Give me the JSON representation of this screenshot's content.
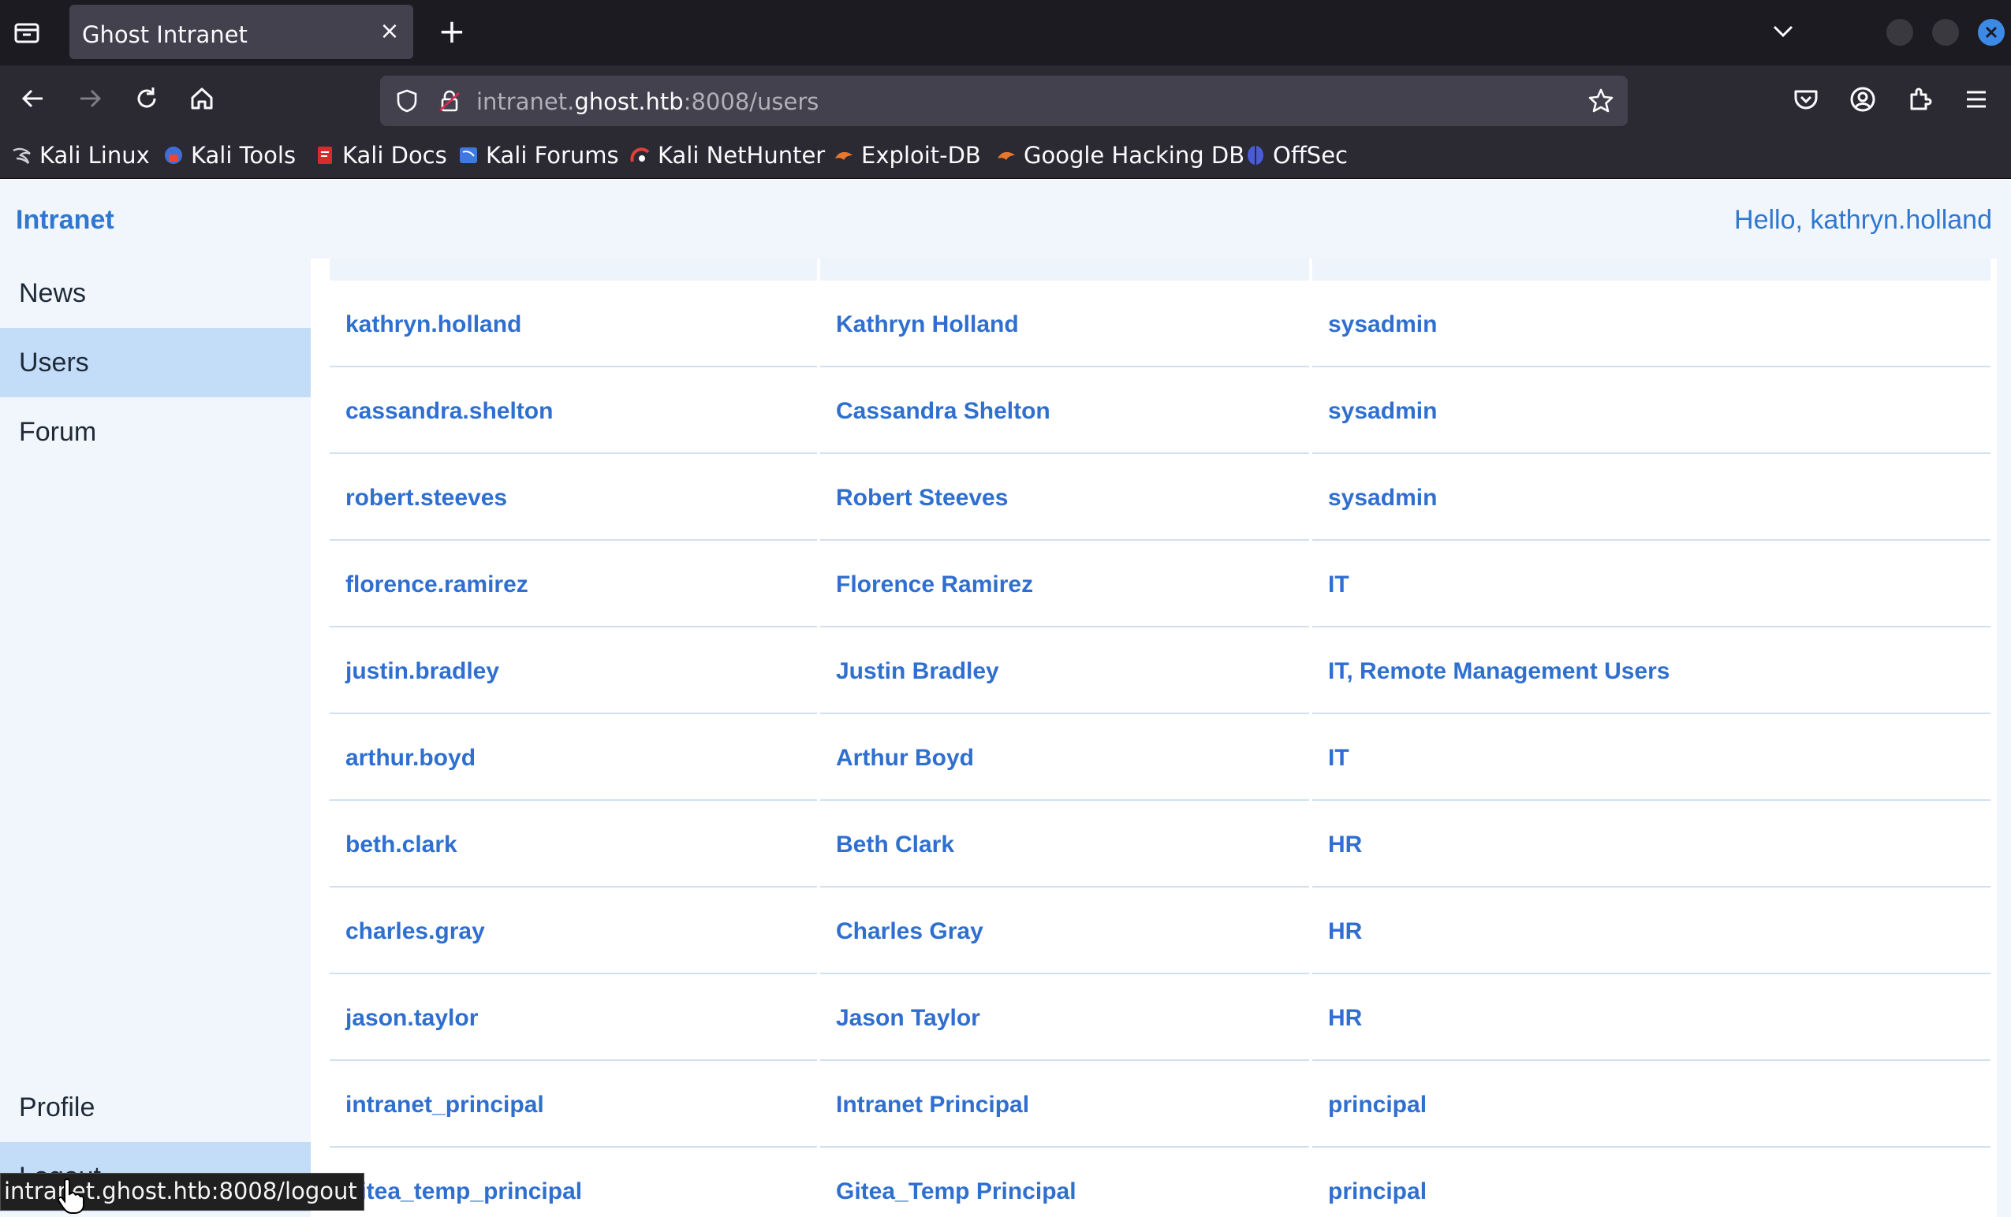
{
  "browser": {
    "tab_title": "Ghost Intranet",
    "url_prefix": "intranet.",
    "url_host": "ghost.htb",
    "url_suffix": ":8008/users",
    "status_url": "intranet.ghost.htb:8008/logout",
    "bookmarks": [
      {
        "label": "Kali Linux",
        "icon": "kali-dragon-icon"
      },
      {
        "label": "Kali Tools",
        "icon": "kali-tools-icon"
      },
      {
        "label": "Kali Docs",
        "icon": "kali-docs-icon"
      },
      {
        "label": "Kali Forums",
        "icon": "kali-forums-icon"
      },
      {
        "label": "Kali NetHunter",
        "icon": "kali-nethunter-icon"
      },
      {
        "label": "Exploit-DB",
        "icon": "exploit-db-icon"
      },
      {
        "label": "Google Hacking DB",
        "icon": "ghdb-icon"
      },
      {
        "label": "OffSec",
        "icon": "offsec-icon"
      }
    ]
  },
  "app": {
    "brand": "Intranet",
    "greeting": "Hello, kathryn.holland"
  },
  "sidebar": {
    "items": [
      {
        "label": "News",
        "active": false
      },
      {
        "label": "Users",
        "active": true
      },
      {
        "label": "Forum",
        "active": false
      }
    ],
    "bottom": [
      {
        "label": "Profile"
      },
      {
        "label": "Logout"
      }
    ]
  },
  "users": {
    "rows": [
      {
        "username": "kathryn.holland",
        "name": "Kathryn Holland",
        "groups": "sysadmin"
      },
      {
        "username": "cassandra.shelton",
        "name": "Cassandra Shelton",
        "groups": "sysadmin"
      },
      {
        "username": "robert.steeves",
        "name": "Robert Steeves",
        "groups": "sysadmin"
      },
      {
        "username": "florence.ramirez",
        "name": "Florence Ramirez",
        "groups": "IT"
      },
      {
        "username": "justin.bradley",
        "name": "Justin Bradley",
        "groups": "IT, Remote Management Users"
      },
      {
        "username": "arthur.boyd",
        "name": "Arthur Boyd",
        "groups": "IT"
      },
      {
        "username": "beth.clark",
        "name": "Beth Clark",
        "groups": "HR"
      },
      {
        "username": "charles.gray",
        "name": "Charles Gray",
        "groups": "HR"
      },
      {
        "username": "jason.taylor",
        "name": "Jason Taylor",
        "groups": "HR"
      },
      {
        "username": "intranet_principal",
        "name": "Intranet Principal",
        "groups": "principal"
      },
      {
        "username": "gitea_temp_principal",
        "name": "Gitea_Temp Principal",
        "groups": "principal"
      }
    ]
  }
}
